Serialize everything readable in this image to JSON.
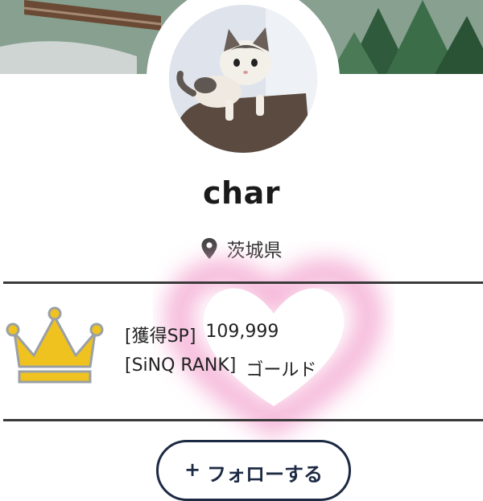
{
  "profile": {
    "username": "char",
    "location": "茨城県"
  },
  "stats": {
    "sp_label": "[獲得SP]",
    "sp_value": "109,999",
    "rank_label": "[SiNQ RANK]",
    "rank_value": "ゴールド"
  },
  "actions": {
    "follow_plus": "+",
    "follow_label": "フォローする"
  },
  "icons": {
    "location": "map-pin-icon",
    "rank": "crown-icon",
    "decoration": "heart-glow"
  },
  "colors": {
    "crown_fill": "#f0c21f",
    "heart_glow": "#f4a9d2",
    "button_border": "#1d2a44"
  }
}
